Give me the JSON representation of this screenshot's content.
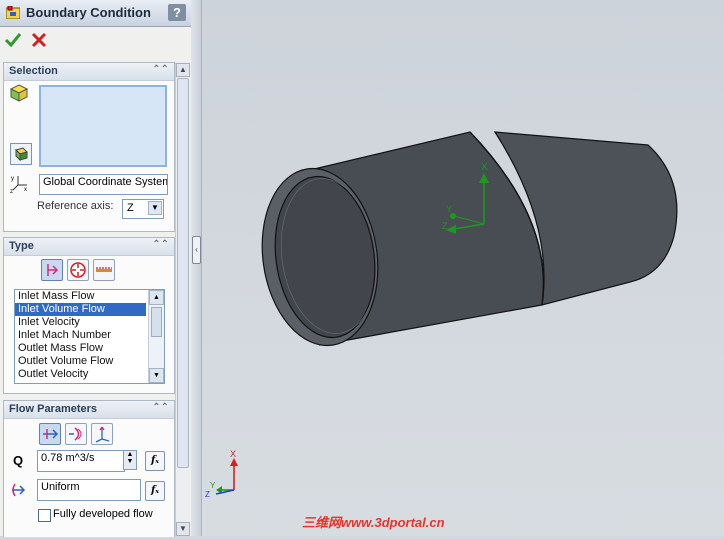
{
  "window": {
    "title": "Boundary Condition",
    "help_label": "?"
  },
  "selection": {
    "header": "Selection",
    "coordinate_system": "Global Coordinate System",
    "reference_axis_label": "Reference axis:",
    "reference_axis_value": "Z"
  },
  "type": {
    "header": "Type",
    "list": [
      "Inlet Mass Flow",
      "Inlet Volume Flow",
      "Inlet Velocity",
      "Inlet Mach Number",
      "Outlet Mass Flow",
      "Outlet Volume Flow",
      "Outlet Velocity"
    ],
    "selected_index": 1
  },
  "flow_parameters": {
    "header": "Flow Parameters",
    "q_label": "Q",
    "q_value": "0.78 m^3/s",
    "profile_value": "Uniform",
    "fully_developed_label": "Fully developed flow",
    "fx_label": "fₓ"
  },
  "viewport": {
    "triad_axes": {
      "x": "X",
      "y": "Y",
      "z": "Z"
    }
  },
  "watermark": {
    "cn": "三维网",
    "url": "www.3dportal.cn"
  },
  "colors": {
    "accent": "#316ac5",
    "part": "#4b5057",
    "axis_x": "#d62020",
    "axis_y": "#1c9a1c",
    "axis_z": "#1d3fcf"
  }
}
